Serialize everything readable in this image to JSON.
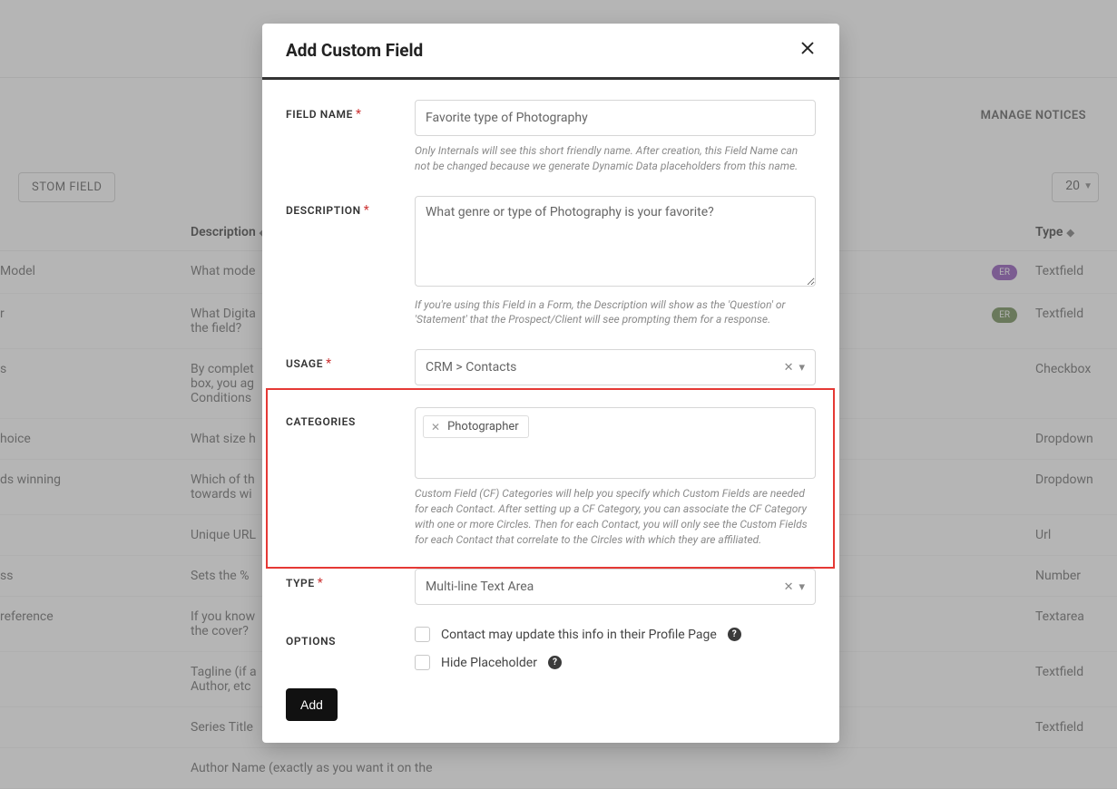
{
  "bg": {
    "tab_notices": "MANAGE NOTICES",
    "btn_custom_field": "STOM FIELD",
    "pagesize": "20",
    "head_desc": "Description",
    "head_type": "Type",
    "rows": [
      {
        "name": " Model",
        "desc": "What mode",
        "badge": "ER",
        "badge_cls": "badge-purple",
        "type": "Textfield"
      },
      {
        "name": "r",
        "desc": "What Digita\nthe field?",
        "badge": "ER",
        "badge_cls": "badge-green",
        "type": "Textfield"
      },
      {
        "name": "s",
        "desc": "By complet\nbox, you ag\nConditions",
        "badge": "",
        "badge_cls": "",
        "type": "Checkbox"
      },
      {
        "name": "hoice",
        "desc": "What size h",
        "badge": "",
        "badge_cls": "",
        "type": "Dropdown"
      },
      {
        "name": "ds winning",
        "desc": "Which of th\ntowards wi",
        "badge": "",
        "badge_cls": "",
        "type": "Dropdown"
      },
      {
        "name": "",
        "desc": "Unique URL",
        "badge": "",
        "badge_cls": "",
        "type": "Url"
      },
      {
        "name": "ss",
        "desc": "Sets the %",
        "badge": "",
        "badge_cls": "",
        "type": "Number"
      },
      {
        "name": "reference",
        "desc": "If you know\nthe cover?",
        "badge": "",
        "badge_cls": "",
        "type": "Textarea"
      },
      {
        "name": "",
        "desc": "Tagline (if a\nAuthor, etc",
        "badge": "",
        "badge_cls": "",
        "type": "Textfield"
      },
      {
        "name": "",
        "desc": "Series Title",
        "badge": "",
        "badge_cls": "",
        "type": "Textfield"
      },
      {
        "name": "",
        "desc": "Author Name (exactly as you want it on the",
        "badge": "",
        "badge_cls": "",
        "type": ""
      }
    ]
  },
  "modal": {
    "title": "Add Custom Field",
    "field_name_label": "FIELD NAME",
    "field_name_value": "Favorite type of Photography",
    "field_name_help": "Only Internals will see this short friendly name. After creation, this Field Name can not be changed because we generate Dynamic Data placeholders from this name.",
    "description_label": "DESCRIPTION",
    "description_value": "What genre or type of Photography is your favorite?",
    "description_help": "If you're using this Field in a Form, the Description will show as the 'Question' or 'Statement' that the Prospect/Client will see prompting them for a response.",
    "usage_label": "USAGE",
    "usage_value": "CRM > Contacts",
    "categories_label": "CATEGORIES",
    "categories_tag": "Photographer",
    "categories_help": "Custom Field (CF) Categories will help you specify which Custom Fields are needed for each Contact. After setting up a CF Category, you can associate the CF Category with one or more Circles. Then for each Contact, you will only see the Custom Fields for each Contact that correlate to the Circles with which they are affiliated.",
    "type_label": "TYPE",
    "type_value": "Multi-line Text Area",
    "options_label": "OPTIONS",
    "opt1": "Contact may update this info in their Profile Page",
    "opt2": "Hide Placeholder",
    "add_btn": "Add"
  }
}
